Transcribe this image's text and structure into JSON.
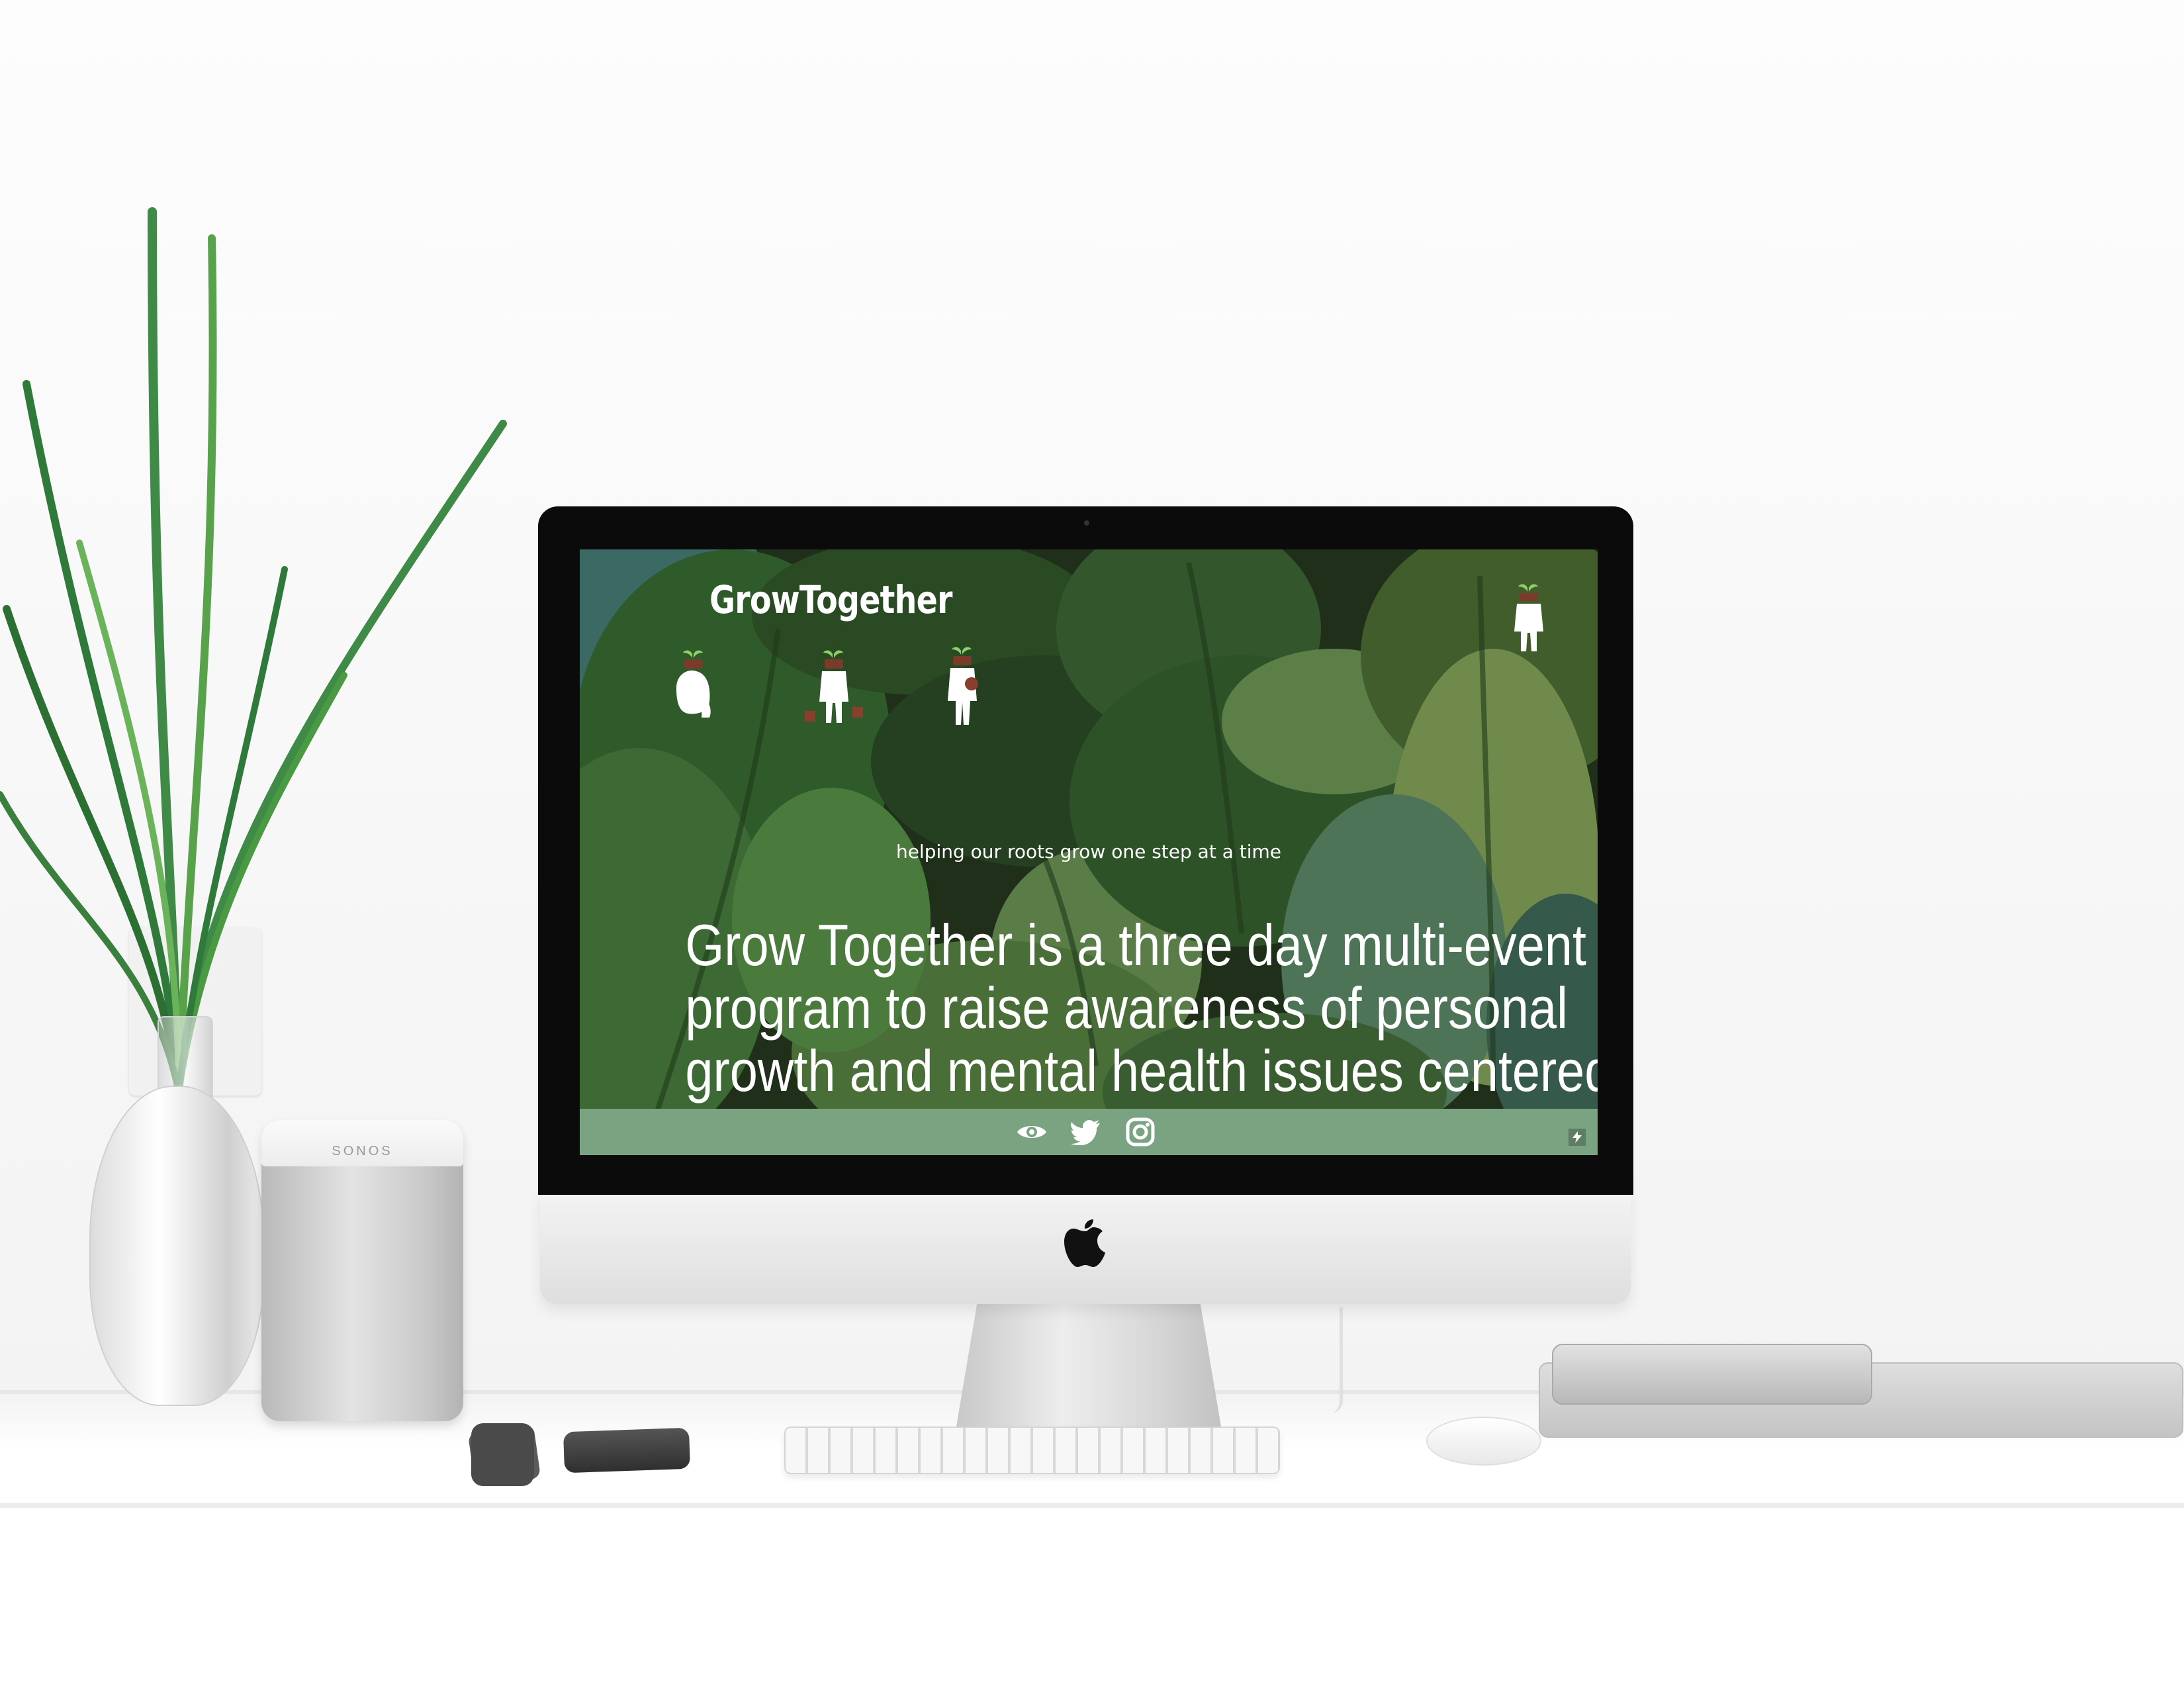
{
  "site": {
    "logo": "GrowTogether",
    "tagline": "helping our roots grow one step at a time",
    "headline_lines": [
      "Grow Together is a three day multi-event",
      "program to raise awareness of personal",
      "growth and mental health issues centered"
    ]
  },
  "footer": {
    "icons": [
      "eye-icon",
      "twitter-icon",
      "instagram-icon"
    ],
    "badge_icon": "bolt-icon"
  },
  "scene": {
    "speaker_label": "SONOS"
  },
  "colors": {
    "footer_bar": "#7aa381",
    "leaf_dark": "#2c4a26",
    "leaf_mid": "#4f7a40",
    "leaf_light": "#7d9a56",
    "text": "#ffffff"
  }
}
